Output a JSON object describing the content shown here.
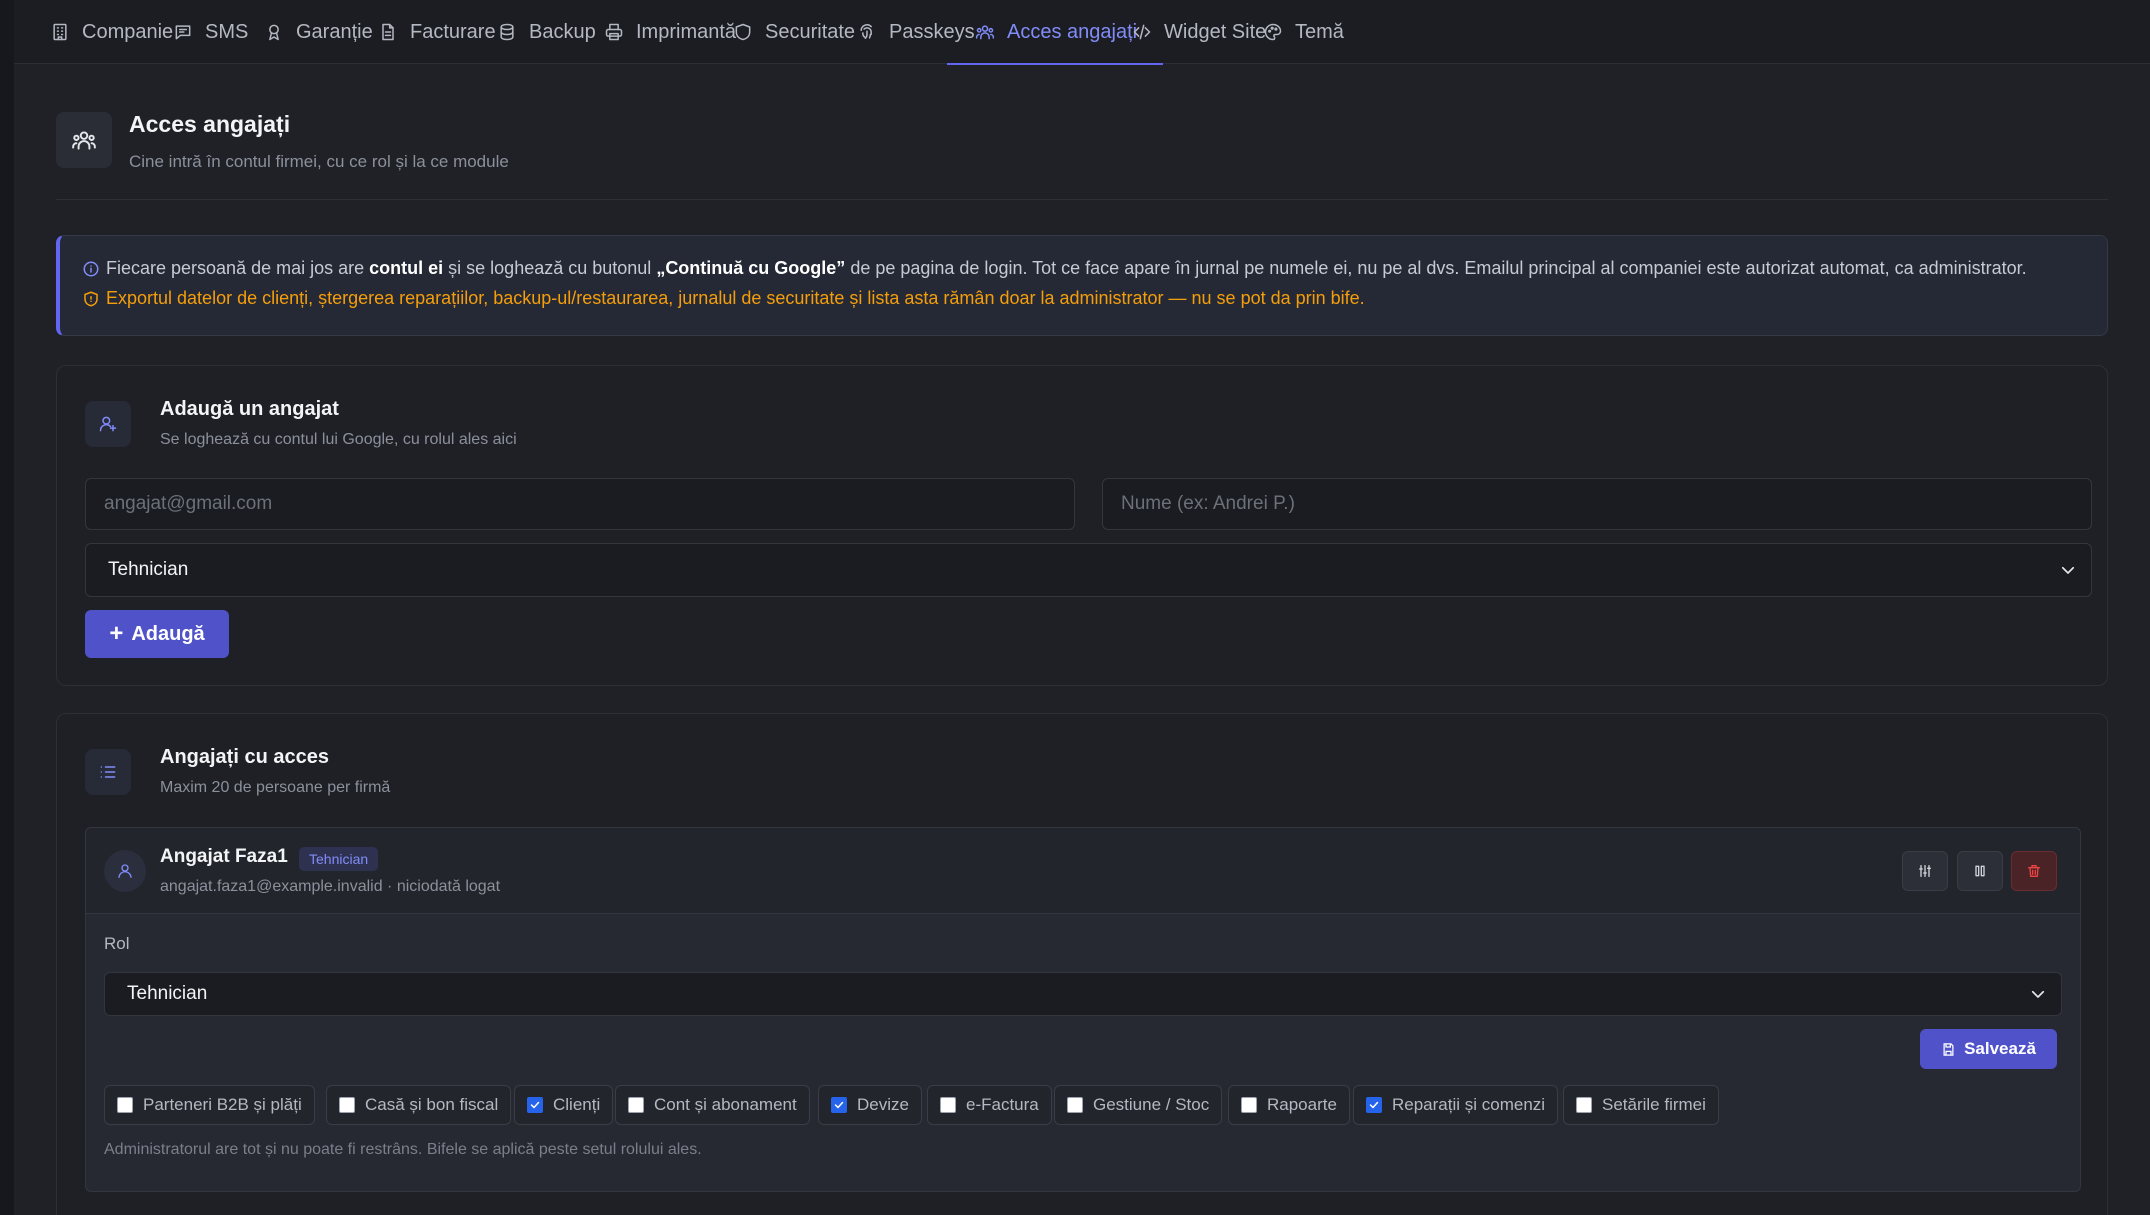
{
  "tabs": [
    {
      "label": "Companie",
      "icon": "building-icon"
    },
    {
      "label": "SMS",
      "icon": "message-icon"
    },
    {
      "label": "Garanție",
      "icon": "award-icon"
    },
    {
      "label": "Facturare",
      "icon": "file-icon"
    },
    {
      "label": "Backup",
      "icon": "database-icon"
    },
    {
      "label": "Imprimantă",
      "icon": "printer-icon"
    },
    {
      "label": "Securitate",
      "icon": "shield-icon"
    },
    {
      "label": "Passkeys",
      "icon": "fingerprint-icon"
    },
    {
      "label": "Acces angajați",
      "icon": "users-icon",
      "active": true
    },
    {
      "label": "Widget Site",
      "icon": "code-icon"
    },
    {
      "label": "Temă",
      "icon": "palette-icon"
    }
  ],
  "page": {
    "title": "Acces angajați",
    "subtitle": "Cine intră în contul firmei, cu ce rol și la ce module"
  },
  "info": {
    "l1_pre": "Fiecare persoană de mai jos are ",
    "l1_b1": "contul ei",
    "l1_mid": " și se loghează cu butonul ",
    "l1_b2": "„Continuă cu Google”",
    "l1_post": " de pe pagina de login. Tot ce face apare în jurnal pe numele ei, nu pe al dvs. Emailul principal al companiei este autorizat automat, ca administrator.",
    "l2": "Exportul datelor de clienți, ștergerea reparațiilor, backup-ul/restaurarea, jurnalul de securitate și lista asta rămân doar la administrator — nu se pot da prin bife."
  },
  "add": {
    "title": "Adaugă un angajat",
    "subtitle": "Se loghează cu contul lui Google, cu rolul ales aici",
    "email_placeholder": "angajat@gmail.com",
    "name_placeholder": "Nume (ex: Andrei P.)",
    "role": "Tehnician",
    "button": "Adaugă"
  },
  "list": {
    "title": "Angajați cu acces",
    "subtitle": "Maxim 20 de persoane per firmă"
  },
  "employee": {
    "name": "Angajat Faza1",
    "badge": "Tehnician",
    "meta": "angajat.faza1@example.invalid · niciodată logat",
    "role_label": "Rol",
    "role": "Tehnician",
    "save": "Salvează",
    "permissions": [
      {
        "label": "Parteneri B2B și plăți",
        "checked": false
      },
      {
        "label": "Casă și bon fiscal",
        "checked": false
      },
      {
        "label": "Clienți",
        "checked": true
      },
      {
        "label": "Cont și abonament",
        "checked": false
      },
      {
        "label": "Devize",
        "checked": true
      },
      {
        "label": "e-Factura",
        "checked": false
      },
      {
        "label": "Gestiune / Stoc",
        "checked": false
      },
      {
        "label": "Rapoarte",
        "checked": false
      },
      {
        "label": "Reparații și comenzi",
        "checked": true
      },
      {
        "label": "Setările firmei",
        "checked": false
      }
    ],
    "note": "Administratorul are tot și nu poate fi restrâns. Bifele se aplică peste setul rolului ales."
  },
  "colors": {
    "accent": "#6366f1",
    "warning": "#f59e0b",
    "danger": "#ef4444"
  }
}
